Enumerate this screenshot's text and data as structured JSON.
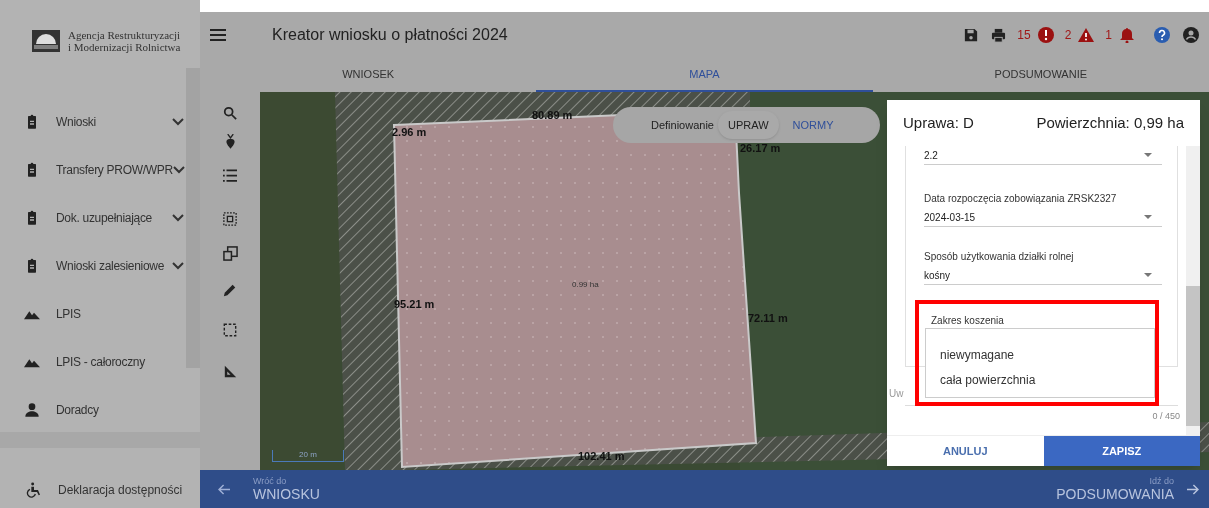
{
  "sidebar": {
    "logo_text": [
      "Agencja Restrukturyzacji",
      "i Modernizacji Rolnictwa"
    ],
    "items": [
      {
        "label": "Wnioski",
        "kind": "clipboard",
        "expandable": true
      },
      {
        "label": "Transfery PROW/WPR",
        "kind": "clipboard",
        "expandable": true
      },
      {
        "label": "Dok. uzupełniające",
        "kind": "clipboard",
        "expandable": true
      },
      {
        "label": "Wnioski zalesieniowe",
        "kind": "clipboard",
        "expandable": true
      },
      {
        "label": "LPIS",
        "kind": "terrain",
        "expandable": false
      },
      {
        "label": "LPIS - całoroczny",
        "kind": "terrain",
        "expandable": false
      },
      {
        "label": "Doradcy",
        "kind": "person",
        "expandable": false
      }
    ],
    "footer_item": {
      "label": "Deklaracja dostępności"
    }
  },
  "header": {
    "title": "Kreator wniosku o płatności 2024",
    "errors": "15",
    "warnings": "2",
    "notifications": "1"
  },
  "tabs": [
    {
      "label": "WNIOSEK",
      "selected": false
    },
    {
      "label": "MAPA",
      "selected": true
    },
    {
      "label": "PODSUMOWANIE",
      "selected": false
    }
  ],
  "map": {
    "mode_label": "Definiowanie",
    "modes": [
      {
        "label": "UPRAW",
        "selected": true
      },
      {
        "label": "NORMY",
        "selected": false
      }
    ],
    "labels": [
      "80.89 m",
      "2.96 m",
      "26.17 m",
      "95.21 m",
      "0.99 ha",
      "72.11 m",
      "102.41 m"
    ],
    "scale": "20 m"
  },
  "dialog": {
    "crop": "Uprawa: D",
    "area": "Powierzchnia: 0,99 ha",
    "fields": [
      {
        "value": "2.2"
      },
      {
        "label": "Data rozpoczęcia zobowiązania ZRSK2327",
        "value": "2024-03-15"
      },
      {
        "label": "Sposób użytkowania działki rolnej",
        "value": "kośny"
      }
    ],
    "open_field": {
      "label": "Zakres koszenia",
      "options": [
        "niewymagane",
        "cała powierzchnia"
      ]
    },
    "notes_label": "Uw",
    "counter": "0 / 450",
    "buttons": [
      "ANULUJ",
      "ZAPISZ"
    ]
  },
  "bottom_bar": {
    "back_caption": "Wróć do",
    "back_label": "WNIOSKU",
    "next_caption": "Idź do",
    "next_label": "PODSUMOWANIA"
  }
}
